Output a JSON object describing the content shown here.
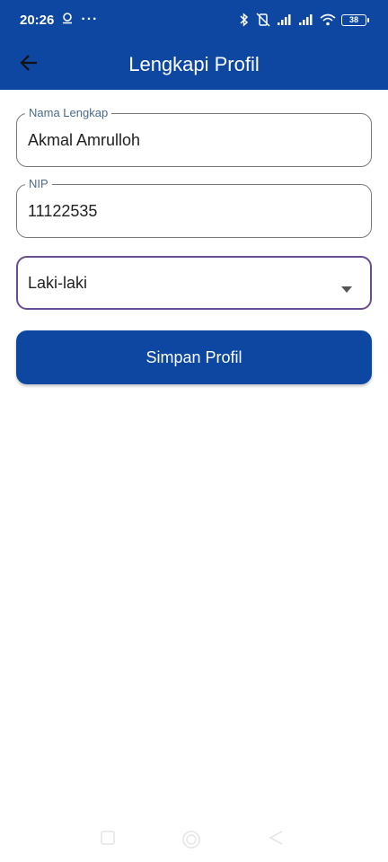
{
  "status_bar": {
    "time": "20:26",
    "more": "···",
    "battery": "38",
    "icons": [
      "assistant-icon",
      "bluetooth-icon",
      "vibrate-off-icon",
      "signal-icon",
      "signal-icon",
      "wifi-icon",
      "battery-icon"
    ]
  },
  "app_bar": {
    "title": "Lengkapi Profil",
    "back_icon": "arrow-back-icon"
  },
  "form": {
    "name_label": "Nama Lengkap",
    "name_value": "Akmal Amrulloh",
    "nip_label": "NIP",
    "nip_value": "11122535",
    "gender_value": "Laki-laki",
    "save_label": "Simpan Profil"
  },
  "nav_bar": {
    "icons": [
      "recent-apps-icon",
      "home-icon",
      "back-icon"
    ]
  },
  "colors": {
    "primary": "#0d47a1",
    "focus_border": "#6a4c93",
    "label": "#4a6a8a"
  }
}
